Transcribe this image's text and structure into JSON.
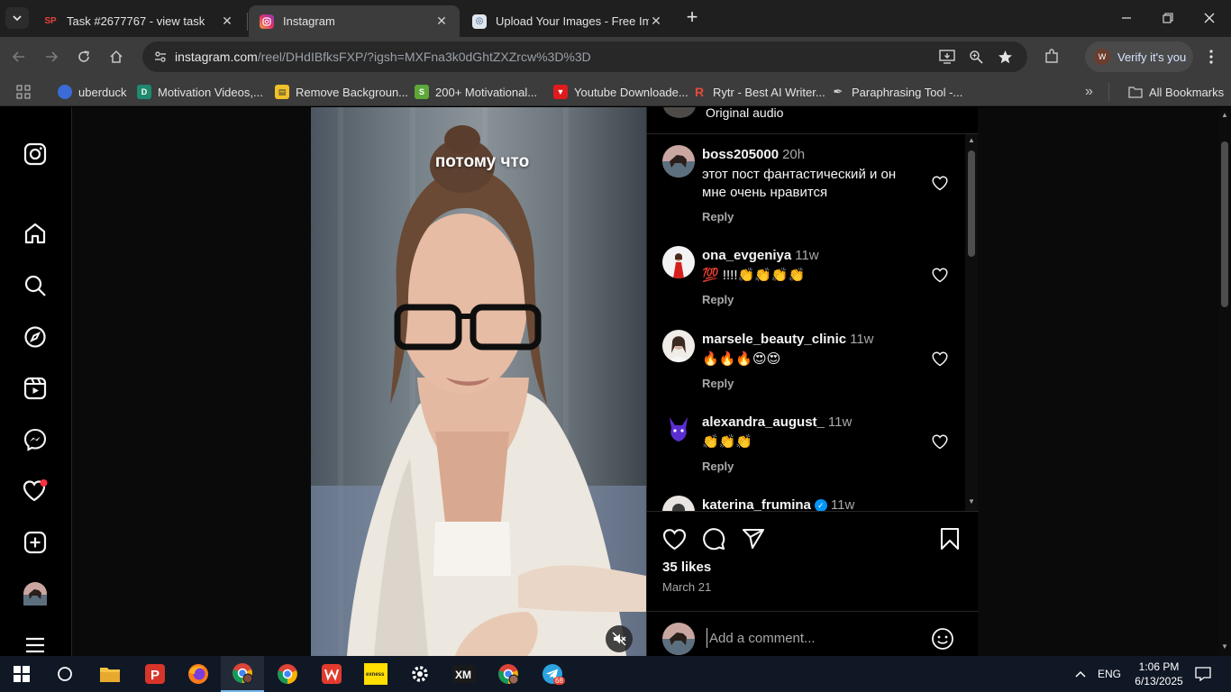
{
  "browser": {
    "tabs": [
      {
        "title": "Task #2677767 - view task",
        "favicon": "sp-icon",
        "active": false
      },
      {
        "title": "Instagram",
        "favicon": "instagram-icon",
        "active": true
      },
      {
        "title": "Upload Your Images - Free Imag",
        "favicon": "upload-icon",
        "active": false
      }
    ],
    "url_host": "instagram.com",
    "url_rest": "/reel/DHdIBfksFXP/?igsh=MXFna3k0dGhtZXZrcw%3D%3D",
    "profile_chip": "Verify it's you",
    "bookmarks": [
      {
        "label": "uberduck",
        "icon": "uberduck-icon",
        "color": "#3a6bd6"
      },
      {
        "label": "Motivation Videos,...",
        "icon": "motivation-icon",
        "color": "#1f8a6e"
      },
      {
        "label": "Remove Backgroun...",
        "icon": "remove-bg-icon",
        "color": "#f0c02b"
      },
      {
        "label": "200+ Motivational...",
        "icon": "shopify-icon",
        "color": "#5ea83a"
      },
      {
        "label": "Youtube Downloade...",
        "icon": "youtube-dl-icon",
        "color": "#e01b1b"
      },
      {
        "label": "Rytr - Best AI Writer...",
        "icon": "rytr-icon",
        "color": "#e5493a"
      },
      {
        "label": "Paraphrasing Tool -...",
        "icon": "quill-icon",
        "color": "#cfcfcf"
      }
    ],
    "all_bookmarks": "All Bookmarks"
  },
  "reel": {
    "caption": "потому что",
    "original_audio": "Original audio",
    "comments": [
      {
        "user": "boss205000",
        "time": "20h",
        "text": "этот пост фантастический и он мне очень нравится",
        "reply": "Reply"
      },
      {
        "user": "ona_evgeniya",
        "time": "11w",
        "text": "💯 !!!!👏👏👏👏",
        "reply": "Reply"
      },
      {
        "user": "marsele_beauty_clinic",
        "time": "11w",
        "text": "🔥🔥🔥😍😍",
        "reply": "Reply"
      },
      {
        "user": "alexandra_august_",
        "time": "11w",
        "text": "👏👏👏",
        "reply": "Reply"
      },
      {
        "user": "katerina_frumina",
        "time": "11w",
        "text": "",
        "reply": ""
      }
    ],
    "likes": "35 likes",
    "date": "March 21",
    "comment_placeholder": "Add a comment..."
  },
  "taskbar": {
    "language": "ENG",
    "time": "1:06 PM",
    "date": "6/13/2025",
    "telegram_badge": "68"
  }
}
